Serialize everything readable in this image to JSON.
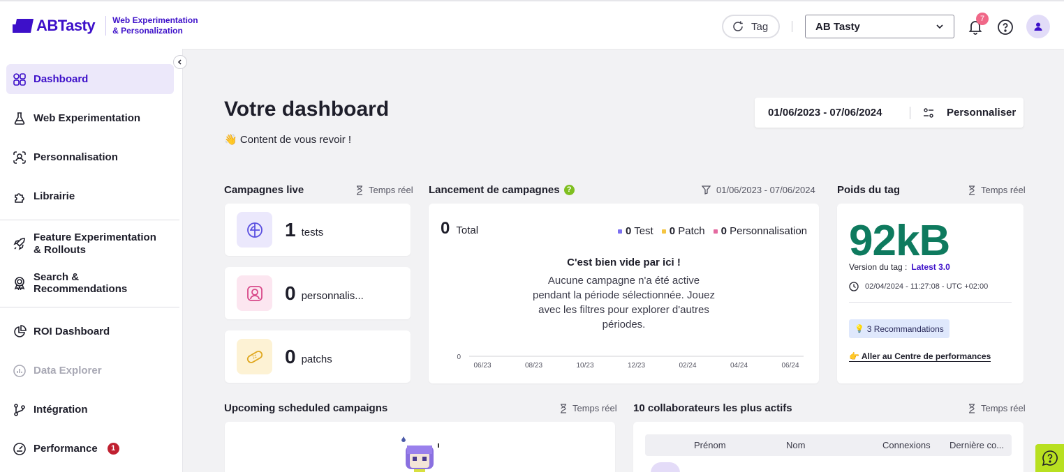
{
  "header": {
    "brand": "ABTasty",
    "brand_sub_line1": "Web Experimentation",
    "brand_sub_line2": "& Personalization",
    "tag_button": "Tag",
    "account_select": "AB Tasty",
    "notification_count": "7",
    "accent_color": "#3d10c9"
  },
  "sidebar": {
    "items": [
      {
        "label": "Dashboard",
        "icon": "grid-icon"
      },
      {
        "label": "Web Experimentation",
        "icon": "flask-icon"
      },
      {
        "label": "Personnalisation",
        "icon": "user-scan-icon"
      },
      {
        "label": "Librairie",
        "icon": "puzzle-icon"
      },
      {
        "label": "Feature Experimentation & Rollouts",
        "icon": "rocket-icon"
      },
      {
        "label": "Search & Recommendations",
        "icon": "award-icon"
      },
      {
        "label": "ROI Dashboard",
        "icon": "pie-chart-icon"
      },
      {
        "label": "Data Explorer",
        "icon": "chart-box-icon"
      },
      {
        "label": "Intégration",
        "icon": "git-branch-icon"
      },
      {
        "label": "Performance",
        "icon": "gauge-icon",
        "badge": "1"
      }
    ]
  },
  "main": {
    "title": "Votre dashboard",
    "subtitle": "👋 Content de vous revoir !",
    "date_range": "01/06/2023 - 07/06/2024",
    "customize": "Personnaliser"
  },
  "live_campaigns": {
    "title": "Campagnes live",
    "realtime": "Temps réel",
    "cards": [
      {
        "value": "1",
        "label": "tests",
        "icon": "ab-test-icon"
      },
      {
        "value": "0",
        "label": "personnalis...",
        "icon": "personalization-icon"
      },
      {
        "value": "0",
        "label": "patchs",
        "icon": "bandage-icon"
      }
    ]
  },
  "launches": {
    "title": "Lancement de campagnes",
    "filter_range": "01/06/2023 - 07/06/2024",
    "total_value": "0",
    "total_label": "Total",
    "legend": [
      {
        "value": "0",
        "label": "Test",
        "color": "#7b6ff0"
      },
      {
        "value": "0",
        "label": "Patch",
        "color": "#f5c542"
      },
      {
        "value": "0",
        "label": "Personnalisation",
        "color": "#e46aa0"
      }
    ],
    "empty_title": "C'est bien vide par ici !",
    "empty_text": "Aucune campagne n'a été active pendant la période sélectionnée. Jouez avec les filtres pour explorer d'autres périodes.",
    "y_tick": "0",
    "x_ticks": [
      "06/23",
      "08/23",
      "10/23",
      "12/23",
      "02/24",
      "04/24",
      "06/24"
    ]
  },
  "tag_weight": {
    "title": "Poids du tag",
    "realtime": "Temps réel",
    "weight": "92kB",
    "version_label": "Version du tag :",
    "version_value": "Latest 3.0",
    "date": "02/04/2024 - 11:27:08 - UTC +02:00",
    "recommendations": "3 Recommandations",
    "perf_link": "Aller au Centre de performances",
    "weight_color": "#0e7a5e"
  },
  "upcoming": {
    "title": "Upcoming scheduled campaigns",
    "realtime": "Temps réel"
  },
  "collaborators": {
    "title": "10 collaborateurs les plus actifs",
    "realtime": "Temps réel",
    "columns": [
      "Prénom",
      "Nom",
      "Connexions",
      "Dernière co..."
    ]
  }
}
